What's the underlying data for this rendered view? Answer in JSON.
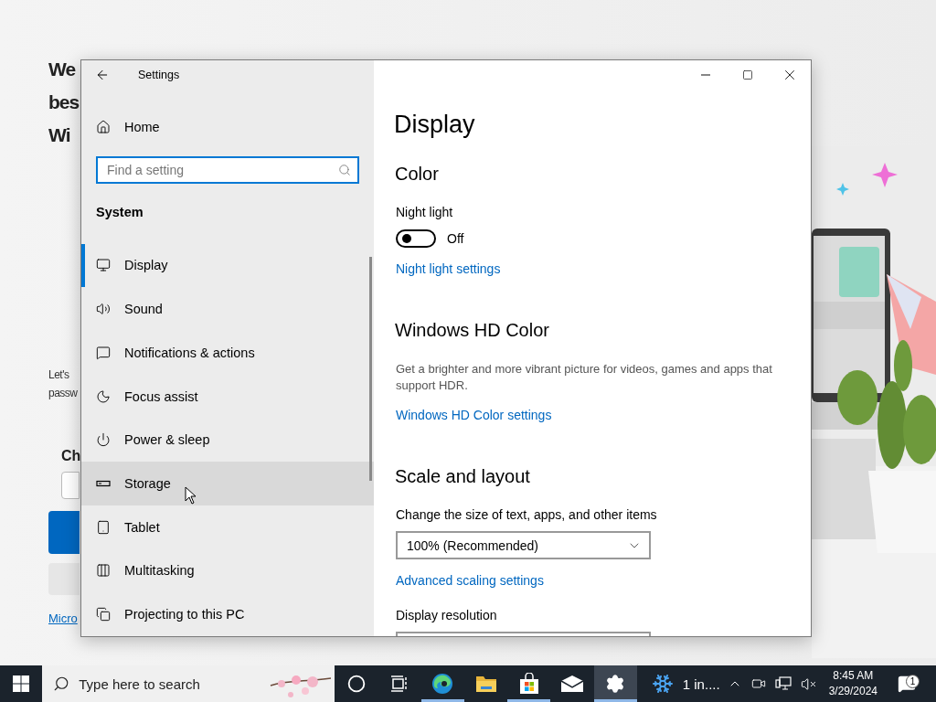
{
  "background_page": {
    "heading_lines": [
      "We",
      "bes",
      "Wi"
    ],
    "body_lines": [
      "Let's",
      "passw"
    ],
    "subheading": "Ch",
    "link": "Micro"
  },
  "settings_window": {
    "title": "Settings",
    "sidebar": {
      "home": "Home",
      "search": {
        "placeholder": "Find a setting"
      },
      "section": "System",
      "items": [
        {
          "label": "Display",
          "kind": "display",
          "selected": true,
          "hovered": false
        },
        {
          "label": "Sound",
          "kind": "sound",
          "selected": false,
          "hovered": false
        },
        {
          "label": "Notifications & actions",
          "kind": "notifications",
          "selected": false,
          "hovered": false
        },
        {
          "label": "Focus assist",
          "kind": "focus",
          "selected": false,
          "hovered": false
        },
        {
          "label": "Power & sleep",
          "kind": "power",
          "selected": false,
          "hovered": false
        },
        {
          "label": "Storage",
          "kind": "storage",
          "selected": false,
          "hovered": true
        },
        {
          "label": "Tablet",
          "kind": "tablet",
          "selected": false,
          "hovered": false
        },
        {
          "label": "Multitasking",
          "kind": "multitasking",
          "selected": false,
          "hovered": false
        },
        {
          "label": "Projecting to this PC",
          "kind": "projecting",
          "selected": false,
          "hovered": false
        }
      ]
    },
    "content": {
      "page_title": "Display",
      "sections": [
        {
          "heading": "Color",
          "items": [
            {
              "kind": "label",
              "text": "Night light"
            },
            {
              "kind": "toggle",
              "on": false,
              "text": "Off"
            },
            {
              "kind": "link",
              "text": "Night light settings"
            }
          ]
        },
        {
          "heading": "Windows HD Color",
          "items": [
            {
              "kind": "paragraph",
              "text": "Get a brighter and more vibrant picture for videos, games and apps that support HDR."
            },
            {
              "kind": "link",
              "text": "Windows HD Color settings"
            }
          ]
        },
        {
          "heading": "Scale and layout",
          "items": [
            {
              "kind": "label",
              "text": "Change the size of text, apps, and other items"
            },
            {
              "kind": "dropdown",
              "value": "100% (Recommended)"
            },
            {
              "kind": "link",
              "text": "Advanced scaling settings"
            },
            {
              "kind": "label",
              "text": "Display resolution"
            },
            {
              "kind": "dropdown"
            }
          ]
        }
      ]
    }
  },
  "taskbar": {
    "search": {
      "placeholder": "Type here to search"
    },
    "apps": [
      {
        "kind": "cortana",
        "running": false,
        "selected": false
      },
      {
        "kind": "task_view",
        "running": false,
        "selected": false
      },
      {
        "kind": "edge",
        "running": true,
        "selected": false
      },
      {
        "kind": "explorer",
        "running": false,
        "selected": false
      },
      {
        "kind": "store",
        "running": true,
        "selected": false
      },
      {
        "kind": "mail",
        "running": false,
        "selected": false
      },
      {
        "kind": "settings",
        "running": true,
        "selected": true
      }
    ],
    "weather": "1 in....",
    "clock": {
      "time": "8:45 AM",
      "date": "3/29/2024"
    },
    "notification_count": "1"
  }
}
